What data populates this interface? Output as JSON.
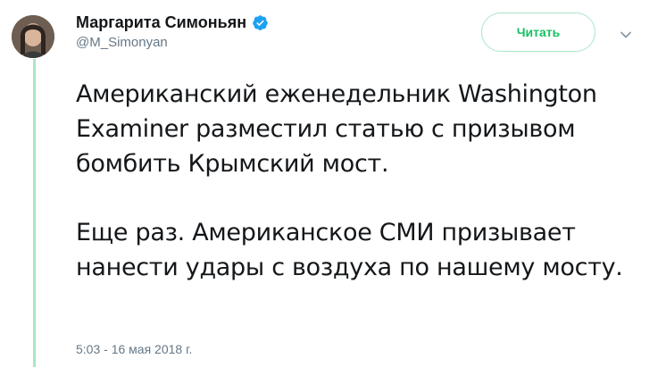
{
  "author": {
    "name": "Маргарита Симоньян",
    "handle": "@M_Simonyan",
    "verified": true,
    "verified_icon": "verified-badge-icon"
  },
  "actions": {
    "follow_label": "Читать",
    "more_icon": "chevron-down-icon"
  },
  "tweet": {
    "paragraphs": [
      "Американский еженедельник Washington Examiner разместил статью с призывом бомбить Крымский мост.",
      "Еще раз. Американское СМИ призывает нанести удары с воздуха по нашему мосту."
    ],
    "timestamp": "5:03 - 16 мая 2018 г."
  },
  "colors": {
    "accent": "#1da1f2",
    "follow_text": "#17bf63",
    "thread_line": "#a8e6c6",
    "secondary_text": "#657786"
  }
}
